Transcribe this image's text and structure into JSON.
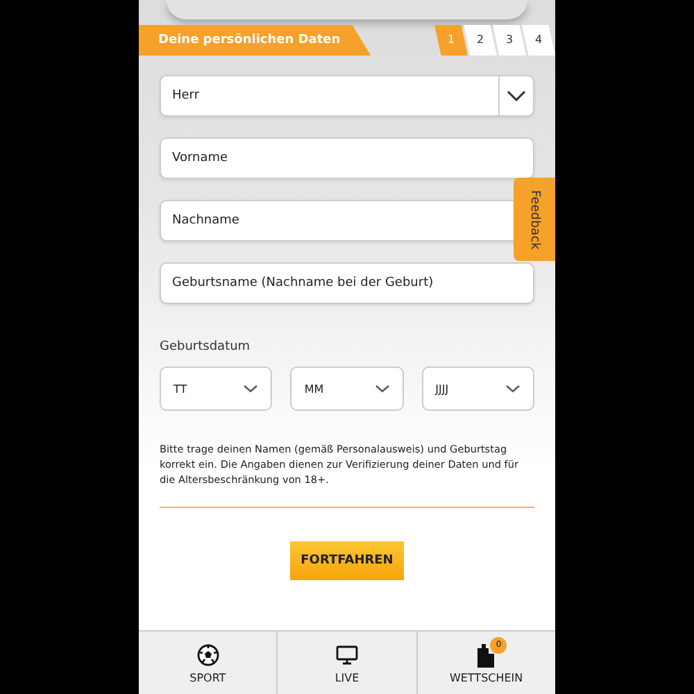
{
  "header": {
    "title": "Deine persönlichen Daten"
  },
  "steps": [
    {
      "label": "1",
      "selected": true
    },
    {
      "label": "2",
      "selected": false
    },
    {
      "label": "3",
      "selected": false
    },
    {
      "label": "4",
      "selected": false
    }
  ],
  "salutation": {
    "value": "Herr"
  },
  "fields": [
    {
      "placeholder": "Vorname"
    },
    {
      "placeholder": "Nachname"
    },
    {
      "placeholder": "Geburtsname (Nachname bei der Geburt)"
    }
  ],
  "birthdate": {
    "label": "Geburtsdatum",
    "selects": [
      "TT",
      "MM",
      "JJJJ"
    ]
  },
  "notice": "Bitte trage deinen Namen (gemäß Personalausweis) und Geburtstag korrekt ein. Die Angaben dienen zur Verifizierung deiner Daten und für die Altersbeschränkung von 18+.",
  "continue_button": "FORTFAHREN",
  "feedback_tab": "Feedback",
  "tab_bar": [
    {
      "kind": "sport",
      "label": "SPORT"
    },
    {
      "kind": "live",
      "label": "LIVE"
    },
    {
      "kind": "betslip",
      "label": "WETTSCHEIN",
      "badge": "0"
    }
  ]
}
